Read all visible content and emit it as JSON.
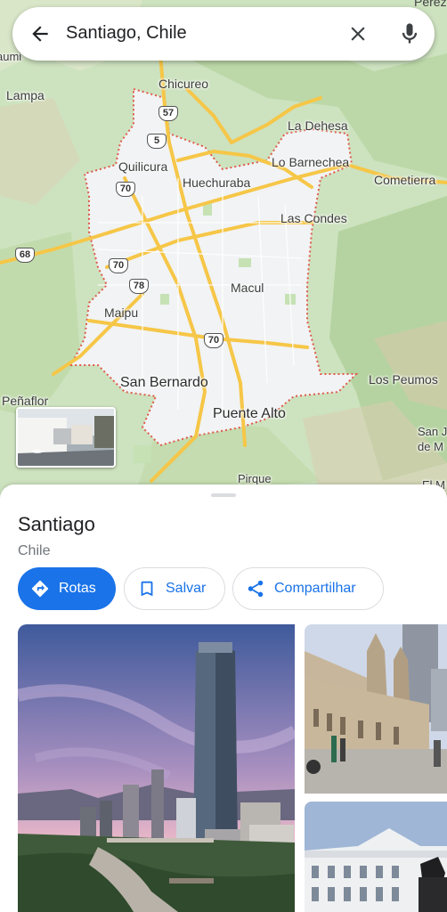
{
  "search": {
    "query": "Santiago, Chile",
    "corner_text": "Pérez"
  },
  "map": {
    "labels": {
      "chicureo": "Chicureo",
      "lampa": "Lampa",
      "la_dehesa": "La Dehesa",
      "lo_barnechea": "Lo Barnechea",
      "cometierra": "Cometierra",
      "quilicura": "Quilicura",
      "huechuraba": "Huechuraba",
      "las_condes": "Las Condes",
      "macul": "Macul",
      "maipu": "Maipu",
      "san_bernardo": "San Bernardo",
      "puente_alto": "Puente Alto",
      "los_peumos": "Los Peumos",
      "penaflor": "Peñaflor",
      "san_j": "San J",
      "de_m": "de M",
      "pirque": "Pirque",
      "ite_left": "aumi",
      "el_m": "El M"
    },
    "shields": {
      "r57": "57",
      "r5": "5",
      "r70a": "70",
      "r68": "68",
      "r70b": "70",
      "r78": "78",
      "r70c": "70"
    },
    "colors": {
      "boundary": "#e05a4a",
      "roads": "#f6c647",
      "urban": "#f1f3f4"
    }
  },
  "place": {
    "title": "Santiago",
    "subtitle": "Chile"
  },
  "actions": {
    "routes": "Rotas",
    "save": "Salvar",
    "share": "Compartilhar"
  },
  "accent": "#1a73e8"
}
